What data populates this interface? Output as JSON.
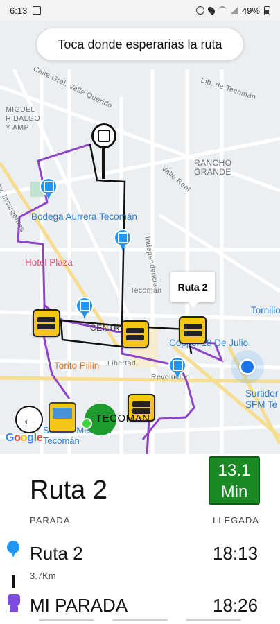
{
  "status_bar": {
    "time": "6:13",
    "battery": "49%"
  },
  "map": {
    "hint": "Toca donde esperarias la ruta",
    "street_labels": {
      "calle_gral": "Calle Gral. Valle Querido",
      "miguel_hidalgo": "MIGUEL\nHIDALGO\nY AMP",
      "rancho_grande": "RANCHO\nGRANDE",
      "insurgentes": "Av. Insurgentes",
      "lib_tecoman": "Lib. de Tecomán",
      "tecoman_small": "Tecomán",
      "centro": "CENTRO",
      "libertad": "Libertad",
      "revolucion": "Revolución",
      "independencia": "Independencia",
      "valle_real": "Valle Real"
    },
    "pois": {
      "bodega": "Bodega Aurrera Tecomán",
      "hotel": "Hotel Plaza",
      "tornillo": "Tornillo",
      "coppel": "Coppel 18 De Julio",
      "torito": "Torito Pillin",
      "surtidor": "Surtidor\nSFM Te",
      "soriana": "Soriana Mercado\nTecomán"
    },
    "callout": "Ruta 2",
    "stop_label": "TECOMAN",
    "google": "Google",
    "colors": {
      "route_purple": "#8e44c9",
      "route_black": "#111111",
      "eta_green": "#1b8a24"
    }
  },
  "panel": {
    "route_title": "Ruta 2",
    "eta_value": "13.1",
    "eta_unit": "Min",
    "col_left": "PARADA",
    "col_right": "LLEGADA",
    "row1": {
      "name": "Ruta 2",
      "time": "18:13",
      "distance": "3.7Km"
    },
    "row2": {
      "name": "MI PARADA",
      "time": "18:26"
    }
  }
}
